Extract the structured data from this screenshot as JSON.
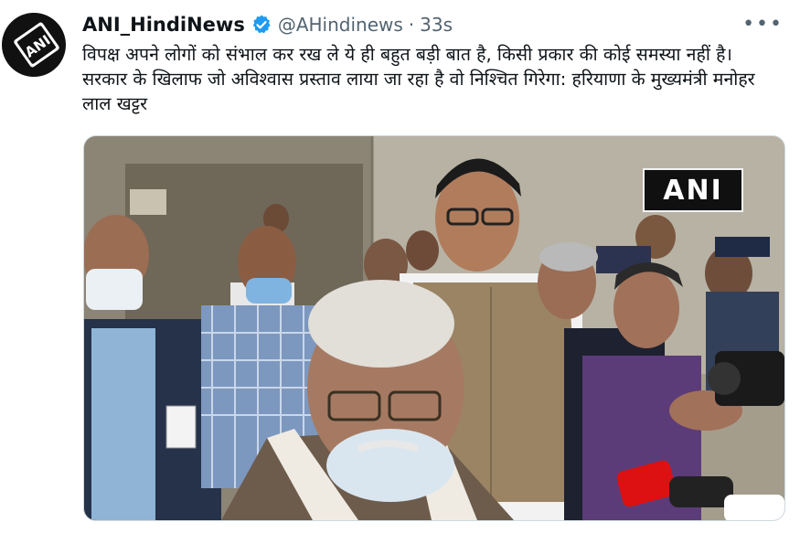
{
  "tweet": {
    "author_name": "ANI_HindiNews",
    "author_handle": "@AHindinews",
    "separator": "·",
    "timestamp": "33s",
    "text": "विपक्ष अपने लोगों को संभाल कर रख ले ये ही बहुत बड़ी बात है, किसी प्रकार की कोई समस्या नहीं है। सरकार के खिलाफ जो अविश्वास प्रस्ताव लाया जा रहा है वो निश्चित गिरेगा: हरियाणा के मुख्यमंत्री मनोहर लाल खट्टर",
    "more_icon": "more-options-icon",
    "verified_icon": "verified-badge-icon",
    "media": {
      "watermark_text": "ANI"
    }
  },
  "colors": {
    "verified_blue": "#1d9bf0",
    "text_primary": "#0f1419",
    "text_secondary": "#536471"
  },
  "avatar_logo_text": "ANI"
}
